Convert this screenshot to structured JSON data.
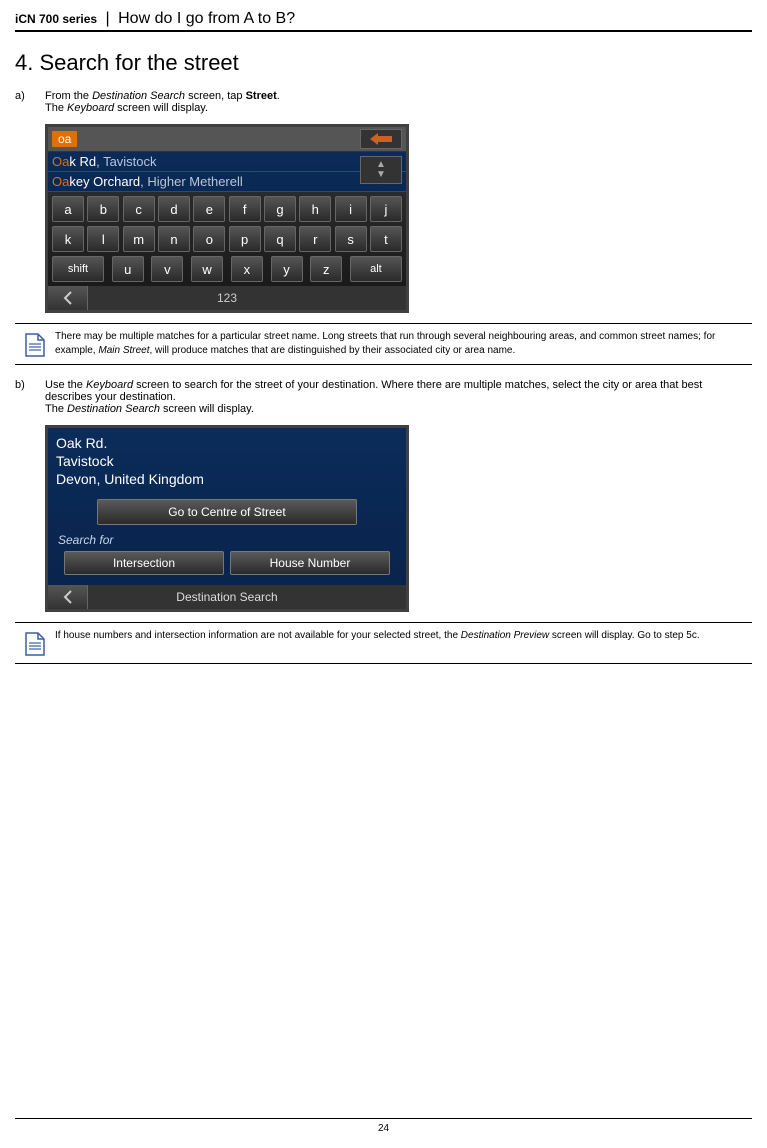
{
  "header": {
    "series": "iCN 700 series",
    "separator": "|",
    "chapter": "How do I go from A to B?"
  },
  "section_title": "4. Search for the street",
  "step_a": {
    "letter": "a)",
    "line1_pre": "From the ",
    "line1_italic": "Destination Search",
    "line1_mid": " screen, tap ",
    "line1_bold": "Street",
    "line1_end": ".",
    "line2_pre": "The ",
    "line2_italic": "Keyboard",
    "line2_end": " screen will display."
  },
  "keyboard_screen": {
    "chip": "oa",
    "suggest1": {
      "hl": "Oa",
      "rest": "k Rd",
      "loc": ", Tavistock"
    },
    "suggest2": {
      "hl": "Oa",
      "rest": "key Orchard",
      "loc": ", Higher Metherell"
    },
    "row1": [
      "a",
      "b",
      "c",
      "d",
      "e",
      "f",
      "g",
      "h",
      "i",
      "j"
    ],
    "row2": [
      "k",
      "l",
      "m",
      "n",
      "o",
      "p",
      "q",
      "r",
      "s",
      "t"
    ],
    "row3_shift": "shift",
    "row3": [
      "u",
      "v",
      "w",
      "x",
      "y",
      "z"
    ],
    "row3_alt": "alt",
    "bottom_123": "123"
  },
  "note1": {
    "pre": "There may be multiple matches for a particular street name. Long streets that run through several neighbouring areas, and common street names; for example, ",
    "italic": "Main Street",
    "post": ", will produce matches that are distinguished by their associated city or area name."
  },
  "step_b": {
    "letter": "b)",
    "line1_pre": "Use the ",
    "line1_italic": "Keyboard",
    "line1_post": " screen to search for the street of your destination. Where there are multiple matches, select the city or area that best describes your destination.",
    "line2_pre": "The ",
    "line2_italic": "Destination Search",
    "line2_end": " screen will display."
  },
  "dest_screen": {
    "addr1": "Oak Rd.",
    "addr2": "Tavistock",
    "addr3": "Devon, United Kingdom",
    "main_btn": "Go to Centre of Street",
    "search_for": "Search for",
    "btn_left": "Intersection",
    "btn_right": "House Number",
    "footer_title": "Destination Search"
  },
  "note2": {
    "pre": "If house numbers and intersection information are not available for your selected street, the ",
    "italic": "Destination Preview",
    "post": " screen will display. Go to step 5c."
  },
  "page_number": "24"
}
